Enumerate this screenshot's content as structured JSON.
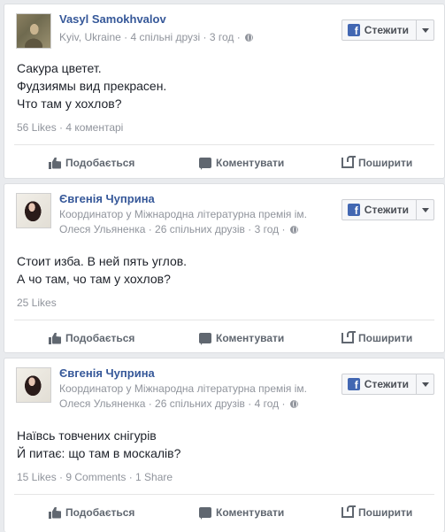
{
  "colors": {
    "link": "#365899",
    "meta": "#90949c",
    "action": "#606770",
    "fb_blue": "#4267b2"
  },
  "posts": [
    {
      "author": "Vasyl Samokhvalov",
      "meta_line": "Kyiv, Ukraine · 4 спільні друзі · 3 год ·",
      "follow_label": "Стежити",
      "text": [
        "Сакура цветет.",
        "Фудзиямы вид прекрасен.",
        "Что там у хохлов?"
      ],
      "stats": "56 Likes · 4 коментарі",
      "actions": {
        "like": "Подобається",
        "comment": "Коментувати",
        "share": "Поширити"
      }
    },
    {
      "author": "Євгенія Чуприна",
      "job_line": "Координатор у Міжнародна літературна премія ім.",
      "meta_line": "Олеся Ульяненка · 26 спільних друзів · 3 год ·",
      "follow_label": "Стежити",
      "text": [
        "Стоит изба. В ней пять углов.",
        "А чо там, чо там у хохлов?"
      ],
      "stats": "25 Likes",
      "actions": {
        "like": "Подобається",
        "comment": "Коментувати",
        "share": "Поширити"
      }
    },
    {
      "author": "Євгенія Чуприна",
      "job_line": "Координатор у Міжнародна літературна премія ім.",
      "meta_line": "Олеся Ульяненка · 26 спільних друзів · 4 год ·",
      "follow_label": "Стежити",
      "text": [
        "Наївсь товчених снігурів",
        "Й питає: що там в москалів?"
      ],
      "stats": "15 Likes · 9 Comments · 1 Share",
      "actions": {
        "like": "Подобається",
        "comment": "Коментувати",
        "share": "Поширити"
      }
    }
  ]
}
